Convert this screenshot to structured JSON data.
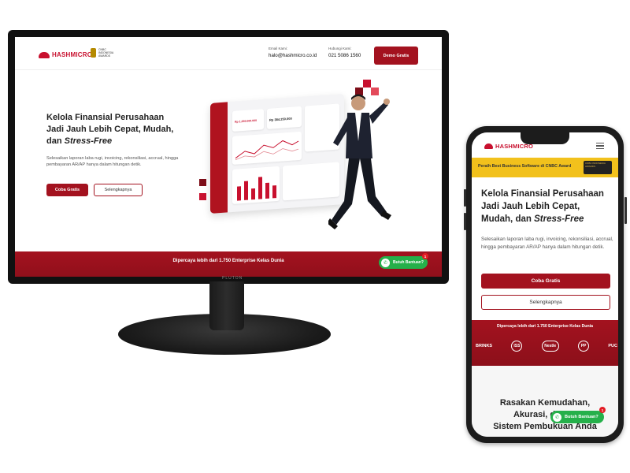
{
  "desktop": {
    "brand": "HASHMICRO",
    "award_text": "CNBC INDONESIA AWARDS",
    "contact_email_label": "Email Kami:",
    "contact_email": "halo@hashmicro.co.id",
    "contact_phone_label": "Hubungi Kami:",
    "contact_phone": "021 5086 1560",
    "demo_button": "Demo Gratis",
    "hero_title_line1": "Kelola Finansial Perusahaan",
    "hero_title_line2": "Jadi Jauh Lebih Cepat, Mudah,",
    "hero_title_prefix": "dan ",
    "hero_title_emphasis": "Stress-Free",
    "hero_desc": "Selesaikan laporan laba rugi, invoicing, rekonsiliasi, accrual, hingga pembayaran AR/AP hanya dalam hitungan detik.",
    "cta_primary": "Coba Gratis",
    "cta_secondary": "Selengkapnya",
    "dashboard_value1": "Rp 1.250.000.000",
    "dashboard_value2": "Rp 384.250.000",
    "trust_band": "Dipercaya lebih dari 1.750 Enterprise Kelas Dunia",
    "whatsapp_label": "Butuh Bantuan?",
    "whatsapp_badge": "1",
    "monitor_brand": "PLUTON"
  },
  "mobile": {
    "brand": "HASHMICRO",
    "award_banner": "Peraih Best Business Software di CNBC Award",
    "award_seal": "CNBC INDONESIA AWARDS",
    "hero_title_line1": "Kelola Finansial Perusahaan",
    "hero_title_line2": "Jadi Jauh Lebih Cepat,",
    "hero_title_prefix": "Mudah, dan ",
    "hero_title_emphasis": "Stress-Free",
    "hero_desc": "Selesaikan laporan laba rugi, invoicing, rekonsiliasi, accrual, hingga pembayaran AR/AP hanya dalam hitungan detik.",
    "cta_primary": "Coba Gratis",
    "cta_secondary": "Selengkapnya",
    "trust_band": "Dipercaya lebih dari 1.750 Enterprise Kelas Dunia",
    "client_logos": [
      "BRINKS",
      "ISS",
      "Nestle",
      "PP",
      "PUC"
    ],
    "section_title_line1": "Rasakan Kemudahan,",
    "section_title_line2": "Akurasi, dan Ef",
    "section_title_line3": "Sistem Pembukuan Anda",
    "whatsapp_label": "Butuh Bantuan?",
    "whatsapp_badge": "1"
  },
  "colors": {
    "brand_red": "#a3121f",
    "accent_red": "#c8102e",
    "whatsapp_green": "#25b04a",
    "award_yellow": "#f2c11c"
  },
  "icons": [
    "hashmicro-logo-icon",
    "award-seal-icon",
    "whatsapp-icon",
    "hamburger-menu-icon"
  ]
}
